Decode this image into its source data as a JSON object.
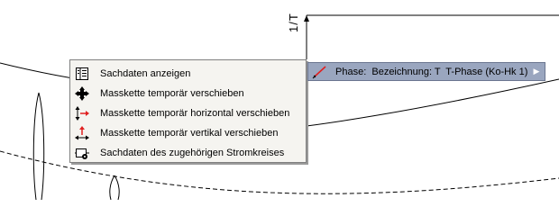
{
  "drawing": {
    "dimension_label": "1/T"
  },
  "context_menu": {
    "items": [
      {
        "label": "Sachdaten anzeigen",
        "icon": "data-sheet-icon"
      },
      {
        "label": "Masskette temporär verschieben",
        "icon": "move-cross-icon"
      },
      {
        "label": "Masskette temporär horizontal verschieben",
        "icon": "move-horizontal-icon"
      },
      {
        "label": "Masskette temporär vertikal verschieben",
        "icon": "move-vertical-icon"
      },
      {
        "label": "Sachdaten des zugehörigen Stromkreises",
        "icon": "circuit-data-icon"
      }
    ]
  },
  "submenu": {
    "label": "Phase:  Bezeichnung: T  T-Phase (Ko-Hk 1)",
    "icon": "phase-line-icon",
    "arrow": "submenu-arrow-icon"
  },
  "colors": {
    "menu_bg": "#f5f4f0",
    "highlight_bg": "#9aa6bf",
    "accent_red": "#e02020"
  }
}
